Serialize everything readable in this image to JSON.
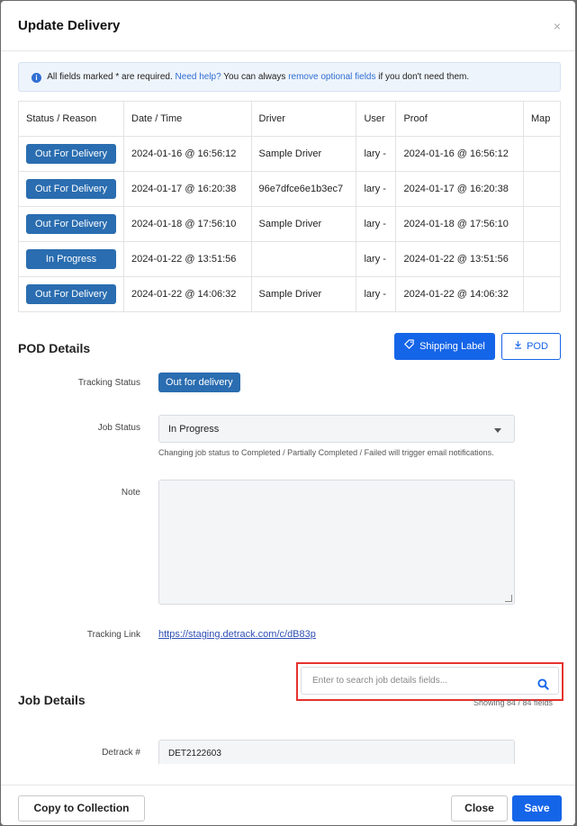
{
  "header": {
    "title": "Update Delivery",
    "close_glyph": "×"
  },
  "info": {
    "text_before": "All fields marked * are required.",
    "help_link": "Need help?",
    "text_mid": "You can always",
    "optional_link": "remove optional fields",
    "text_after": "if you don't need them."
  },
  "history": {
    "columns": [
      "Status / Reason",
      "Date / Time",
      "Driver",
      "User",
      "Proof",
      "Map"
    ],
    "rows": [
      {
        "status": "Out For Delivery",
        "datetime": "2024-01-16 @ 16:56:12",
        "driver": "Sample Driver",
        "user": "lary -",
        "proof": "2024-01-16 @ 16:56:12",
        "map": ""
      },
      {
        "status": "Out For Delivery",
        "datetime": "2024-01-17 @ 16:20:38",
        "driver": "96e7dfce6e1b3ec7",
        "user": "lary -",
        "proof": "2024-01-17 @ 16:20:38",
        "map": ""
      },
      {
        "status": "Out For Delivery",
        "datetime": "2024-01-18 @ 17:56:10",
        "driver": "Sample Driver",
        "user": "lary -",
        "proof": "2024-01-18 @ 17:56:10",
        "map": ""
      },
      {
        "status": "In Progress",
        "datetime": "2024-01-22 @ 13:51:56",
        "driver": "",
        "user": "lary -",
        "proof": "2024-01-22 @ 13:51:56",
        "map": ""
      },
      {
        "status": "Out For Delivery",
        "datetime": "2024-01-22 @ 14:06:32",
        "driver": "Sample Driver",
        "user": "lary -",
        "proof": "2024-01-22 @ 14:06:32",
        "map": ""
      }
    ]
  },
  "pod": {
    "title": "POD Details",
    "shipping_label_button": "Shipping Label",
    "pod_button": "POD",
    "tracking_status_label": "Tracking Status",
    "tracking_status_value": "Out for delivery",
    "job_status_label": "Job Status",
    "job_status_value": "In Progress",
    "job_status_hint": "Changing job status to Completed / Partially Completed / Failed will trigger email notifications.",
    "note_label": "Note",
    "note_value": "",
    "tracking_link_label": "Tracking Link",
    "tracking_link_value": "https://staging.detrack.com/c/dB83p"
  },
  "job": {
    "title": "Job Details",
    "search_placeholder": "Enter to search job details fields...",
    "count_text": "Showing 84 / 84 fields",
    "detrack_label": "Detrack #",
    "detrack_value": "DET2122603"
  },
  "footer": {
    "copy_button": "Copy to Collection",
    "close_button": "Close",
    "save_button": "Save"
  },
  "colors": {
    "primary": "#1565e8",
    "status_blue": "#2a6db0",
    "highlight_red": "#e5322d"
  }
}
